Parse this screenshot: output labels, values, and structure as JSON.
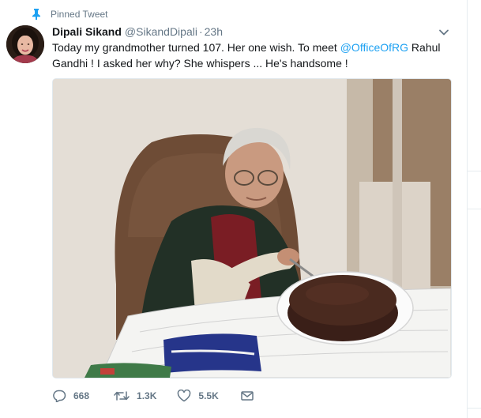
{
  "pinned": {
    "label": "Pinned Tweet",
    "icon": "pin-icon"
  },
  "author": {
    "name": "Dipali Sikand",
    "handle": "@SikandDipali",
    "separator": "·",
    "time": "23h"
  },
  "tweet": {
    "text_before_mention": "Today my grandmother turned 107.  Her one wish.  To meet ",
    "mention": "@OfficeOfRG",
    "text_after_mention": "  Rahul Gandhi !  I asked her why? She whispers ...   He's handsome !"
  },
  "actions": {
    "replies": "668",
    "retweets": "1.3K",
    "likes": "5.5K"
  },
  "icons": {
    "menu": "chevron-down-icon",
    "reply": "reply-icon",
    "retweet": "retweet-icon",
    "like": "heart-icon",
    "message": "envelope-icon"
  },
  "colors": {
    "text": "#14171a",
    "secondary": "#657786",
    "link": "#1da1f2",
    "divider": "#e6ecf0"
  }
}
